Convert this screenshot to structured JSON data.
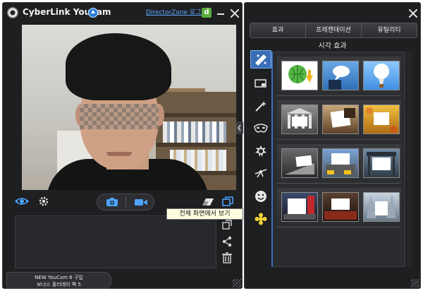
{
  "left_window": {
    "app_title": "CyberLink YouCam",
    "director_zone_link": "DirectorZone 로그인",
    "director_zone_icon_letter": "d",
    "tooltip": "전체 화면에서 보기",
    "promo_line1": "NEW YouCam 6 구입",
    "promo_line2": "보너스 홀리데이 팩 5"
  },
  "right_window": {
    "tabs": [
      "효과",
      "프레젠테이션",
      "유틸리티"
    ],
    "section_title": "시각 효과",
    "categories": [
      "magic-effect-icon",
      "frame-icon",
      "wand-icon",
      "mask-icon",
      "avatar-icon",
      "particle-icon",
      "emoticon-icon",
      "distortion-icon"
    ],
    "effect_rows": 4,
    "effects_per_row": 3
  },
  "colors": {
    "window_bg": "#1e1f21",
    "accent_blue": "#3a6fb8",
    "link": "#5fa8ff",
    "tooltip_bg": "#ffffe1"
  }
}
